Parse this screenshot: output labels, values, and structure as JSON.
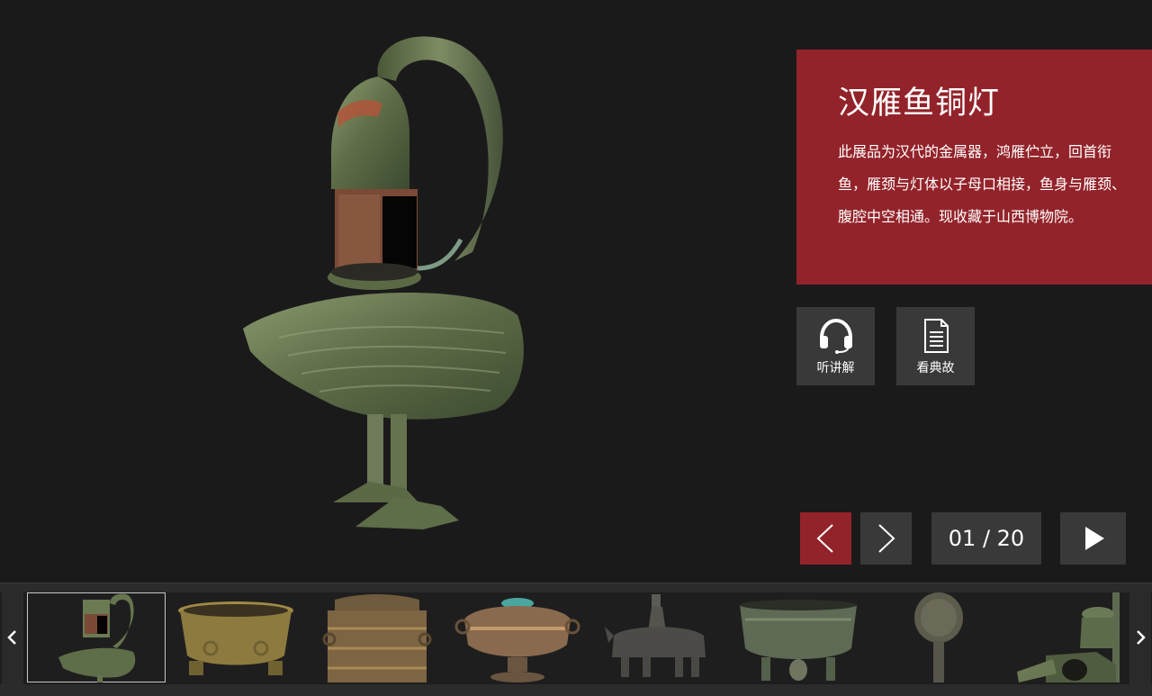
{
  "artifact": {
    "title": "汉雁鱼铜灯",
    "description": "此展品为汉代的金属器，鸿雁伫立，回首衔鱼，雁颈与灯体以子母口相接，鱼身与雁颈、腹腔中空相通。现收藏于山西博物院。"
  },
  "actions": {
    "listen_label": "听讲解",
    "story_label": "看典故"
  },
  "pager": {
    "counter": "01 / 20",
    "current": 1,
    "total": 20
  },
  "icons": {
    "listen": "headphones-icon",
    "story": "document-icon",
    "prev": "chevron-left-icon",
    "next": "chevron-right-icon",
    "play": "play-icon"
  },
  "colors": {
    "accent": "#93232a",
    "background": "#1b1a1b",
    "tile": "#3a393a"
  },
  "thumbnails": [
    {
      "subject": "goose-fish-lamp",
      "active": true
    },
    {
      "subject": "bronze-basin",
      "active": false
    },
    {
      "subject": "lidded-cylinder-vessel",
      "active": false
    },
    {
      "subject": "lidded-dou-vessel",
      "active": false
    },
    {
      "subject": "rider-on-ox-figure",
      "active": false
    },
    {
      "subject": "tripod-cauldron",
      "active": false
    },
    {
      "subject": "bronze-mirror-on-stand",
      "active": false
    },
    {
      "subject": "bronze-lamp-set",
      "active": false
    }
  ]
}
